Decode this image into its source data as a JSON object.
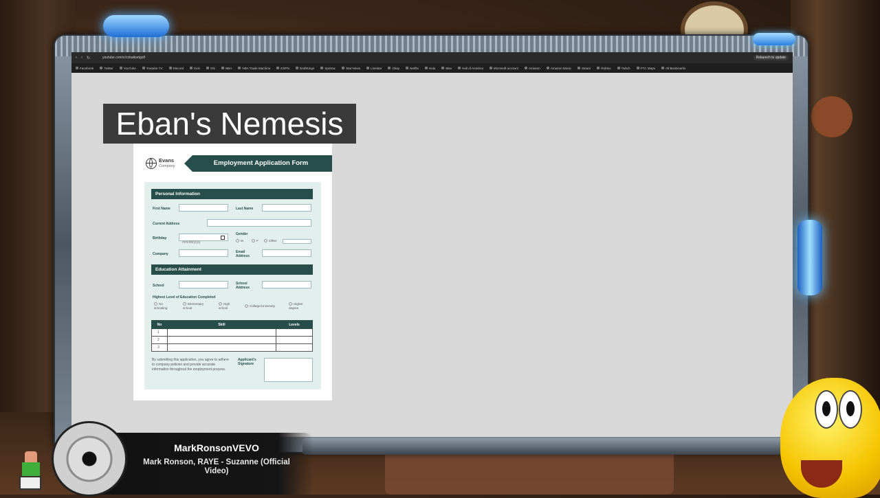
{
  "browser": {
    "url": "youtube.com/c/cobaltsetgolf",
    "update_label": "Relaunch to update",
    "bookmarks": [
      "Facebook",
      "Twitter",
      "YouTube",
      "Youtube TV",
      "Discord",
      "Kick",
      "Gfx",
      "NBA",
      "NBA Trade Machine",
      "ESPN",
      "DraftKings",
      "Spotrac",
      "Stat News",
      "Linestar",
      "Okay",
      "Netflix",
      "Hulu",
      "Max",
      "Hall of America",
      "Microsoft account",
      "Amazon",
      "Amazon Music",
      "Steam",
      "Roblox",
      "Twitch",
      "FTC Maps",
      "All Bookmarks"
    ]
  },
  "overlay": {
    "title": "Eban's Nemesis"
  },
  "form": {
    "company_name": "Evans",
    "company_sub": "Company",
    "banner_title": "Employment Application Form",
    "personal": {
      "header": "Personal Information",
      "first_name": "First Name",
      "last_name": "Last Name",
      "current_address": "Current Address",
      "birthday": "Birthday",
      "birthday_placeholder": "mm/dd/yyyy",
      "gender": "Gender",
      "gender_m": "M",
      "gender_f": "F",
      "gender_other": "Other",
      "company": "Company",
      "email": "Email Address"
    },
    "education": {
      "header": "Education Attainment",
      "school": "School",
      "school_address": "School Address",
      "highest_level": "Highest Level of Education Completed",
      "options": [
        "No schooling",
        "Elementary school",
        "High school",
        "College/University",
        "Higher degree"
      ]
    },
    "skills_table": {
      "headers": [
        "No",
        "Skill",
        "Levels"
      ],
      "rows": [
        "1",
        "2",
        "3"
      ]
    },
    "note": "By submitting this application, you agree to adhere to company policies and provide accurate information throughout the employment process.",
    "signature_label": "Applicant's Signature"
  },
  "now_playing": {
    "channel": "MarkRonsonVEVO",
    "title": "Mark Ronson, RAYE - Suzanne (Official Video)"
  }
}
